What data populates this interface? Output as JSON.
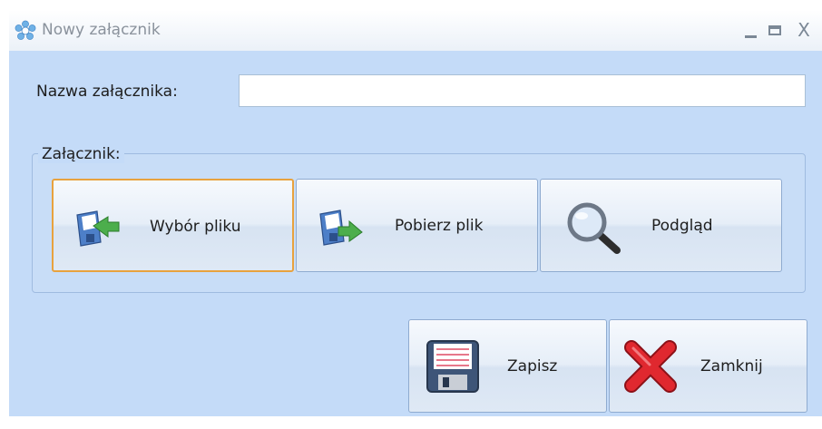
{
  "window": {
    "title": "Nowy załącznik",
    "controls": {
      "minimize": "_",
      "maximize": "□",
      "close": "X"
    }
  },
  "form": {
    "name_label": "Nazwa załącznika:",
    "name_value": "",
    "name_placeholder": ""
  },
  "attachment_group": {
    "legend": "Załącznik:",
    "buttons": [
      {
        "label": "Wybór pliku",
        "icon": "floppy-arrow-in-icon"
      },
      {
        "label": "Pobierz plik",
        "icon": "floppy-arrow-out-icon"
      },
      {
        "label": "Podgląd",
        "icon": "magnifier-icon"
      }
    ]
  },
  "footer": {
    "save_label": "Zapisz",
    "close_label": "Zamknij"
  },
  "colors": {
    "window_bg": "#c4dbf8",
    "focus_border": "#e8a23e",
    "close_red": "#d8232a"
  }
}
